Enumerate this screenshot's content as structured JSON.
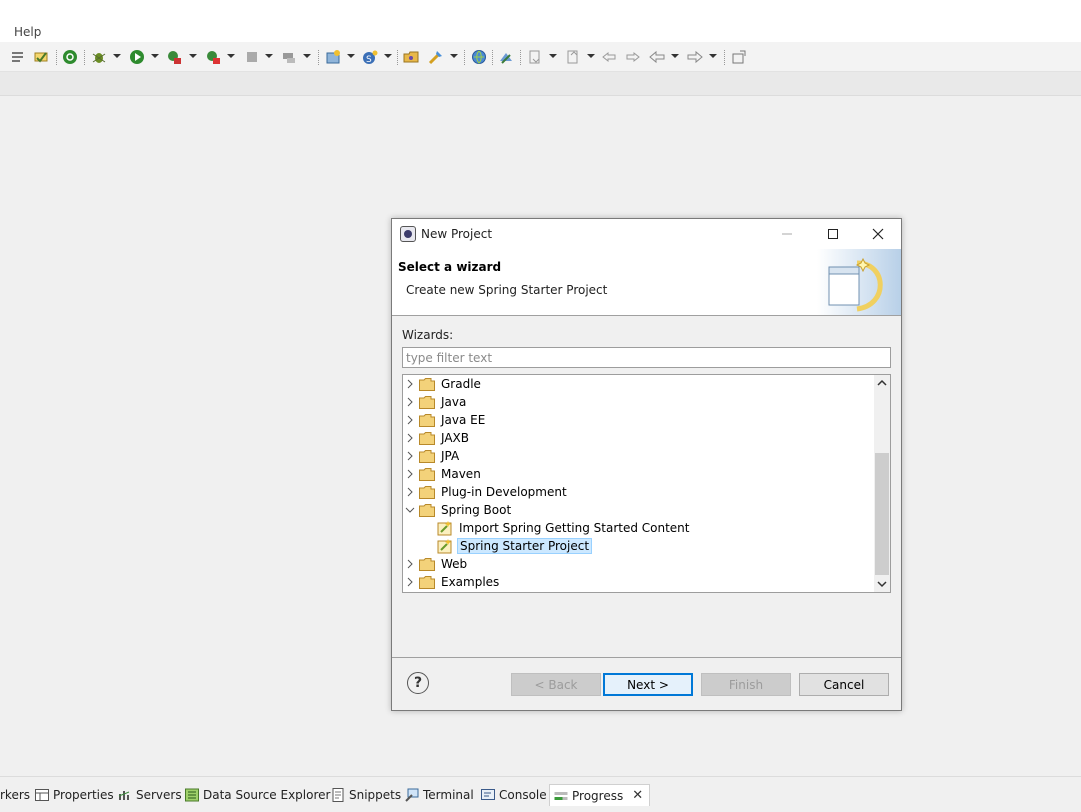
{
  "menubar": {
    "help": "Help"
  },
  "dialog": {
    "title": "New Project",
    "header_title": "Select a wizard",
    "header_desc": "Create new Spring Starter Project",
    "wizards_label": "Wizards:",
    "filter_placeholder": "type filter text",
    "tree": [
      {
        "label": "Gradle",
        "expanded": false
      },
      {
        "label": "Java",
        "expanded": false
      },
      {
        "label": "Java EE",
        "expanded": false
      },
      {
        "label": "JAXB",
        "expanded": false
      },
      {
        "label": "JPA",
        "expanded": false
      },
      {
        "label": "Maven",
        "expanded": false
      },
      {
        "label": "Plug-in Development",
        "expanded": false
      },
      {
        "label": "Spring Boot",
        "expanded": true,
        "children": [
          {
            "label": "Import Spring Getting Started Content",
            "selected": false
          },
          {
            "label": "Spring Starter Project",
            "selected": true
          }
        ]
      },
      {
        "label": "Web",
        "expanded": false
      },
      {
        "label": "Examples",
        "expanded": false
      }
    ],
    "buttons": {
      "back": "< Back",
      "next": "Next >",
      "finish": "Finish",
      "cancel": "Cancel"
    }
  },
  "bottom_tabs": [
    {
      "label": "rkers",
      "icon": "markers-icon"
    },
    {
      "label": "Properties",
      "icon": "properties-icon"
    },
    {
      "label": "Servers",
      "icon": "servers-icon"
    },
    {
      "label": "Data Source Explorer",
      "icon": "data-source-icon"
    },
    {
      "label": "Snippets",
      "icon": "snippets-icon"
    },
    {
      "label": "Terminal",
      "icon": "terminal-icon"
    },
    {
      "label": "Console",
      "icon": "console-icon"
    },
    {
      "label": "Progress",
      "icon": "progress-icon",
      "active": true
    }
  ],
  "colors": {
    "selection": "#cce8ff",
    "default_button_border": "#0078d7",
    "folder": "#e8b84a"
  }
}
